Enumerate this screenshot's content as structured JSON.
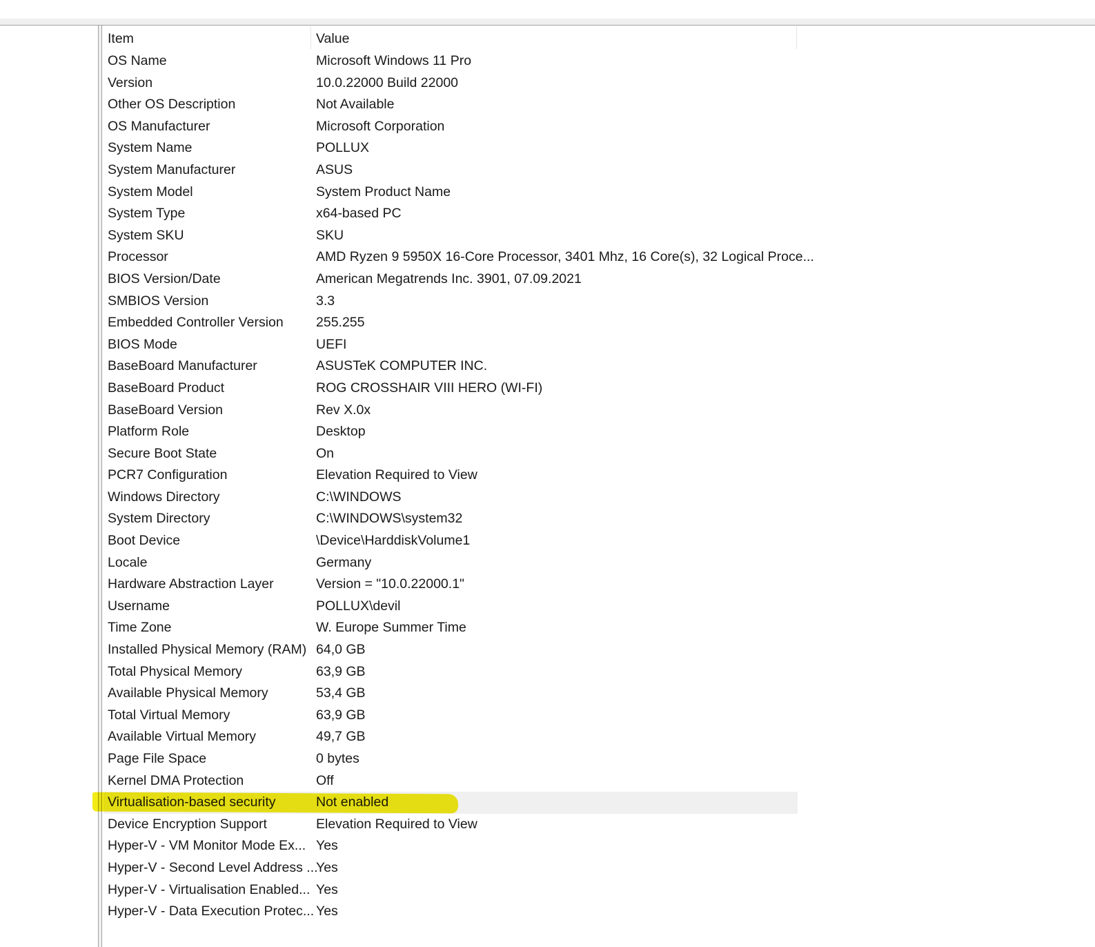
{
  "header": {
    "item": "Item",
    "value": "Value"
  },
  "selected_index": 34,
  "highlight_color": "#f2ea00",
  "rows": [
    {
      "item": "OS Name",
      "value": "Microsoft Windows 11 Pro"
    },
    {
      "item": "Version",
      "value": "10.0.22000 Build 22000"
    },
    {
      "item": "Other OS Description",
      "value": "Not Available"
    },
    {
      "item": "OS Manufacturer",
      "value": "Microsoft Corporation"
    },
    {
      "item": "System Name",
      "value": "POLLUX"
    },
    {
      "item": "System Manufacturer",
      "value": "ASUS"
    },
    {
      "item": "System Model",
      "value": "System Product Name"
    },
    {
      "item": "System Type",
      "value": "x64-based PC"
    },
    {
      "item": "System SKU",
      "value": "SKU"
    },
    {
      "item": "Processor",
      "value": "AMD Ryzen 9 5950X 16-Core Processor, 3401 Mhz, 16 Core(s), 32 Logical Proce..."
    },
    {
      "item": "BIOS Version/Date",
      "value": "American Megatrends Inc. 3901, 07.09.2021"
    },
    {
      "item": "SMBIOS Version",
      "value": "3.3"
    },
    {
      "item": "Embedded Controller Version",
      "value": "255.255"
    },
    {
      "item": "BIOS Mode",
      "value": "UEFI"
    },
    {
      "item": "BaseBoard Manufacturer",
      "value": "ASUSTeK COMPUTER INC."
    },
    {
      "item": "BaseBoard Product",
      "value": "ROG CROSSHAIR VIII HERO (WI-FI)"
    },
    {
      "item": "BaseBoard Version",
      "value": "Rev X.0x"
    },
    {
      "item": "Platform Role",
      "value": "Desktop"
    },
    {
      "item": "Secure Boot State",
      "value": "On"
    },
    {
      "item": "PCR7 Configuration",
      "value": "Elevation Required to View"
    },
    {
      "item": "Windows Directory",
      "value": "C:\\WINDOWS"
    },
    {
      "item": "System Directory",
      "value": "C:\\WINDOWS\\system32"
    },
    {
      "item": "Boot Device",
      "value": "\\Device\\HarddiskVolume1"
    },
    {
      "item": "Locale",
      "value": "Germany"
    },
    {
      "item": "Hardware Abstraction Layer",
      "value": "Version = \"10.0.22000.1\""
    },
    {
      "item": "Username",
      "value": "POLLUX\\devil"
    },
    {
      "item": "Time Zone",
      "value": "W. Europe Summer Time"
    },
    {
      "item": "Installed Physical Memory (RAM)",
      "value": "64,0 GB"
    },
    {
      "item": "Total Physical Memory",
      "value": "63,9 GB"
    },
    {
      "item": "Available Physical Memory",
      "value": "53,4 GB"
    },
    {
      "item": "Total Virtual Memory",
      "value": "63,9 GB"
    },
    {
      "item": "Available Virtual Memory",
      "value": "49,7 GB"
    },
    {
      "item": "Page File Space",
      "value": "0 bytes"
    },
    {
      "item": "Kernel DMA Protection",
      "value": "Off"
    },
    {
      "item": "Virtualisation-based security",
      "value": "Not enabled"
    },
    {
      "item": "Device Encryption Support",
      "value": "Elevation Required to View"
    },
    {
      "item": "Hyper-V - VM Monitor Mode Ex...",
      "value": "Yes"
    },
    {
      "item": "Hyper-V - Second Level Address ...",
      "value": "Yes"
    },
    {
      "item": "Hyper-V - Virtualisation Enabled...",
      "value": "Yes"
    },
    {
      "item": "Hyper-V - Data Execution Protec...",
      "value": "Yes"
    }
  ]
}
